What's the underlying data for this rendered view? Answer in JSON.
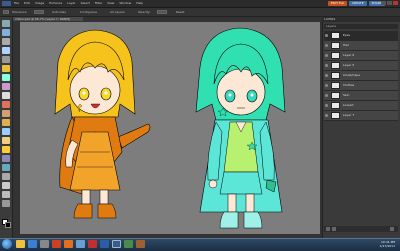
{
  "menubar": {
    "items": [
      "File",
      "Edit",
      "Image",
      "Enhance",
      "Layer",
      "Select",
      "Filter",
      "View",
      "Window",
      "Help"
    ],
    "modes": [
      {
        "label": "EDIT Full",
        "color": "#c8501e"
      },
      {
        "label": "CREATE",
        "color": "#3f6ea8"
      },
      {
        "label": "SHARE",
        "color": "#3f6ea8"
      }
    ]
  },
  "options": {
    "items": [
      "Tolerance:",
      "Anti-alias",
      "Contiguous",
      "All Layers",
      "Opacity:",
      "Reset"
    ]
  },
  "document": {
    "tab_label": "chibis.psd @ 66.7% (Layer 7, RGB/8)"
  },
  "panel": {
    "header": "LAYERS",
    "layers_title": "Layers",
    "layers": [
      {
        "name": "Eyes"
      },
      {
        "name": "Hair"
      },
      {
        "name": "Layer 6"
      },
      {
        "name": "Layer 5"
      },
      {
        "name": "Cloak/Cape"
      },
      {
        "name": "Clothes"
      },
      {
        "name": "Skin"
      },
      {
        "name": "Lineart"
      },
      {
        "name": "Layer 7"
      }
    ]
  },
  "taskbar": {
    "time": "10:41 PM",
    "date": "1/17/2011"
  },
  "colors": {
    "yellow_hair": "#f6c21c",
    "orange_cloak": "#e07b12",
    "orange_dress": "#f2a42a",
    "teal_hair": "#30e0b0",
    "teal_coat": "#5ce6d8",
    "green_shirt": "#b8f070",
    "skin": "#fde8d6",
    "canvas_bg": "#7d7d7d"
  }
}
